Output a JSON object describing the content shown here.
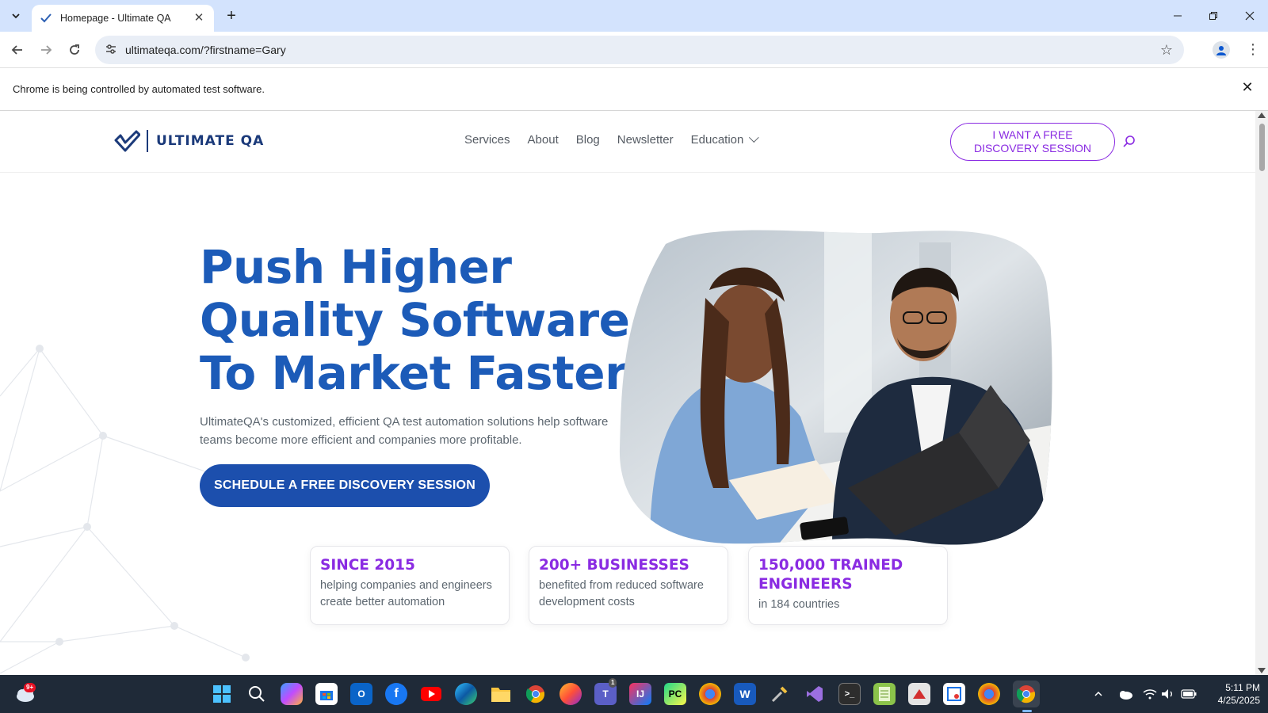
{
  "browser": {
    "tab_title": "Homepage - Ultimate QA",
    "url": "ultimateqa.com/?firstname=Gary",
    "infobar_message": "Chrome is being controlled by automated test software."
  },
  "site": {
    "logo_text": "ULTIMATE QA",
    "nav": [
      {
        "label": "Services"
      },
      {
        "label": "About"
      },
      {
        "label": "Blog"
      },
      {
        "label": "Newsletter"
      },
      {
        "label": "Education"
      }
    ],
    "header_cta": {
      "line1": "I WANT A FREE",
      "line2": "DISCOVERY SESSION"
    },
    "hero": {
      "heading_lines": [
        "Push Higher",
        "Quality Software",
        "To Market Faster"
      ],
      "subtext": "UltimateQA's customized, efficient QA test automation solutions help software teams become more efficient and companies more profitable.",
      "cta": "SCHEDULE A FREE DISCOVERY SESSION"
    },
    "stats": [
      {
        "title": "SINCE 2015",
        "desc": "helping companies and engineers create better automation"
      },
      {
        "title": "200+ BUSINESSES",
        "desc": "benefited from reduced software development costs"
      },
      {
        "title": "150,000 TRAINED ENGINEERS",
        "desc": "in 184 countries"
      }
    ],
    "colors": {
      "primary_blue": "#1c5bb8",
      "button_blue": "#1c4fad",
      "accent_purple": "#8a2be2",
      "logo_navy": "#1b3a7a"
    }
  },
  "taskbar": {
    "weather_badge": "9+",
    "teams_badge": "1",
    "time": "5:11 PM",
    "date": "4/25/2025",
    "apps": [
      "start-icon",
      "search-icon",
      "copilot-icon",
      "store-icon",
      "outlook-icon",
      "facebook-icon",
      "youtube-icon",
      "edge-icon",
      "file-explorer-icon",
      "chrome-icon",
      "firefox-icon",
      "teams-icon",
      "intellij-icon",
      "pycharm-icon",
      "chrome-profile-icon",
      "word-icon",
      "tools-icon",
      "visual-studio-icon",
      "terminal-icon",
      "notepad-icon",
      "app-icon",
      "snipping-icon",
      "chrome-profile2-icon",
      "chrome-active-icon"
    ]
  }
}
